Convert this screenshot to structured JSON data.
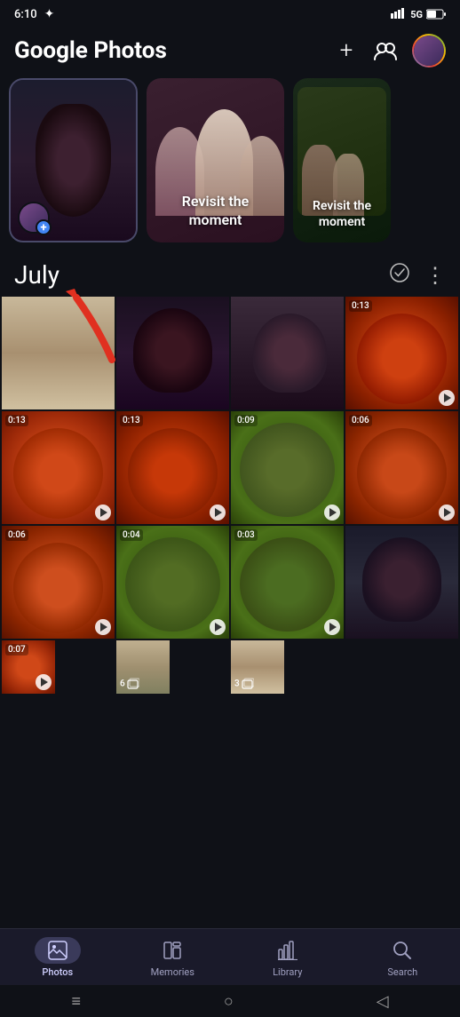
{
  "statusBar": {
    "time": "6:10",
    "signal": "5G",
    "battery": "46"
  },
  "header": {
    "titlePart1": "Google",
    "titlePart2": "Photos",
    "addLabel": "+",
    "shareLabel": "share"
  },
  "stories": [
    {
      "type": "user",
      "hasPlus": true
    },
    {
      "type": "revisit",
      "label": "Revisit the moment"
    },
    {
      "type": "revisit",
      "label": "Revisit the moment"
    }
  ],
  "section": {
    "title": "July",
    "checkIcon": "✓",
    "moreIcon": "⋮"
  },
  "photoGrid": [
    {
      "type": "photo",
      "bg": "photo-corridor",
      "row": 1,
      "col": 1
    },
    {
      "type": "photo",
      "bg": "photo-portrait-dark",
      "row": 1,
      "col": 2
    },
    {
      "type": "photo",
      "bg": "photo-portrait-glasses",
      "row": 1,
      "col": 3
    },
    {
      "type": "video",
      "bg": "photo-soup-1",
      "duration": "0:13",
      "row": 1,
      "col": 4
    },
    {
      "type": "video",
      "bg": "photo-soup-2",
      "duration": "0:13",
      "row": 2,
      "col": 1
    },
    {
      "type": "video",
      "bg": "photo-soup-3",
      "duration": "0:13",
      "row": 2,
      "col": 2
    },
    {
      "type": "video",
      "bg": "photo-soup-green",
      "duration": "0:09",
      "row": 2,
      "col": 3
    },
    {
      "type": "video",
      "bg": "photo-soup-4",
      "duration": "0:06",
      "row": 2,
      "col": 4
    },
    {
      "type": "video",
      "bg": "photo-soup-4",
      "duration": "0:06",
      "row": 3,
      "col": 1
    },
    {
      "type": "video",
      "bg": "photo-soup-green",
      "duration": "0:04",
      "row": 3,
      "col": 2
    },
    {
      "type": "video",
      "bg": "photo-soup-green",
      "duration": "0:03",
      "row": 3,
      "col": 3
    },
    {
      "type": "photo",
      "bg": "photo-portrait-2",
      "row": 3,
      "col": 4
    },
    {
      "type": "video",
      "bg": "photo-soup-2",
      "duration": "0:07",
      "row": 4,
      "col": 1
    },
    {
      "type": "stack",
      "bg": "photo-floor",
      "count": "6",
      "row": 4,
      "col": 2
    },
    {
      "type": "stack",
      "bg": "photo-corridor",
      "count": "3",
      "row": 4,
      "col": 3
    }
  ],
  "bottomNav": {
    "items": [
      {
        "id": "photos",
        "label": "Photos",
        "icon": "🖼",
        "active": true
      },
      {
        "id": "memories",
        "label": "Memories",
        "icon": "📖",
        "active": false
      },
      {
        "id": "library",
        "label": "Library",
        "icon": "📊",
        "active": false
      },
      {
        "id": "search",
        "label": "Search",
        "icon": "🔍",
        "active": false
      }
    ]
  },
  "systemNav": {
    "menuIcon": "≡",
    "homeIcon": "○",
    "backIcon": "◁"
  }
}
